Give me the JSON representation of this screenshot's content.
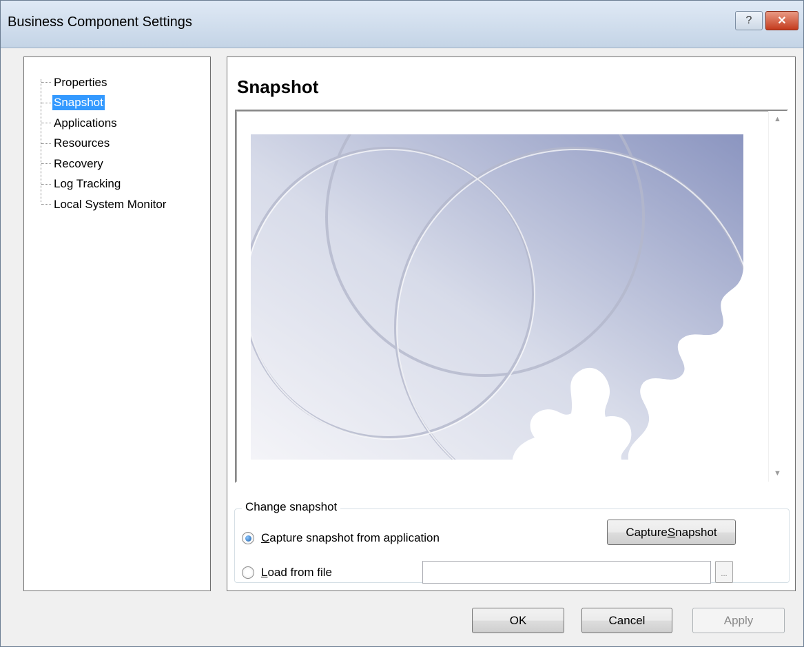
{
  "window": {
    "title": "Business Component Settings",
    "help_label": "?",
    "close_label": "✕"
  },
  "tree": {
    "items": [
      {
        "label": "Properties",
        "selected": false
      },
      {
        "label": "Snapshot",
        "selected": true
      },
      {
        "label": "Applications",
        "selected": false
      },
      {
        "label": "Resources",
        "selected": false
      },
      {
        "label": "Recovery",
        "selected": false
      },
      {
        "label": "Log Tracking",
        "selected": false
      },
      {
        "label": "Local System Monitor",
        "selected": false
      }
    ]
  },
  "panel": {
    "title": "Snapshot",
    "scroll_up": "▲",
    "scroll_down": "▼"
  },
  "change_snapshot": {
    "group_label": "Change snapshot",
    "capture_from_app": {
      "mnemonic": "C",
      "rest": "apture snapshot from application",
      "selected": true
    },
    "load_from_file": {
      "mnemonic": "L",
      "rest": "oad from file",
      "selected": false
    },
    "capture_button": {
      "before": "Capture ",
      "mnemonic": "S",
      "after": "napshot"
    },
    "file_path_value": "",
    "browse_label": "..."
  },
  "footer": {
    "ok_label": "OK",
    "cancel_label": "Cancel",
    "apply_label": "Apply",
    "apply_enabled": false
  },
  "colors": {
    "title_bar": "#c4d4e6",
    "selection": "#3399ff",
    "close_button": "#c43b1d",
    "snapshot_tint": "#9aa3c6"
  }
}
